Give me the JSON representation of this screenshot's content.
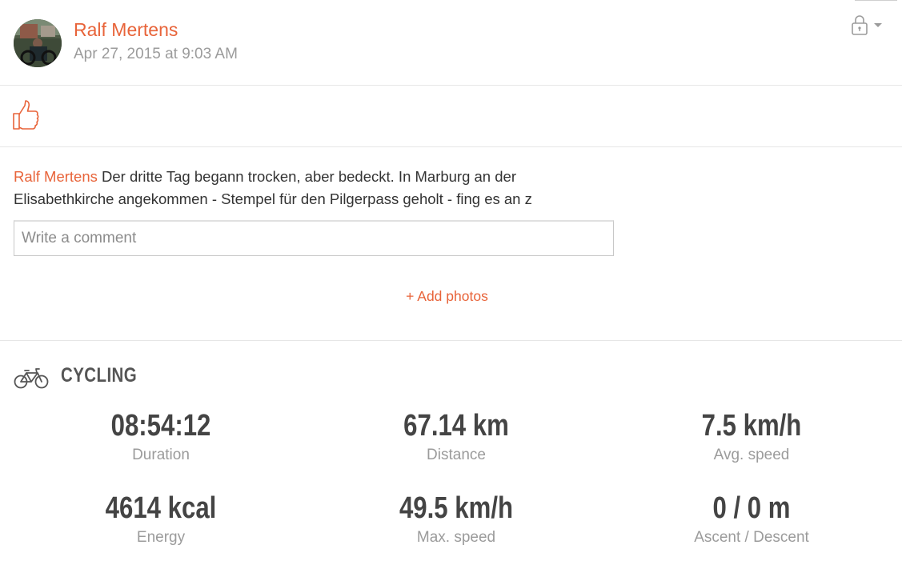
{
  "post": {
    "author": "Ralf Mertens",
    "timestamp": "Apr 27, 2015 at 9:03 AM",
    "text_author": "Ralf Mertens",
    "text_line1": " Der dritte Tag begann trocken, aber bedeckt. In Marburg an der",
    "text_line2": "Elisabethkirche angekommen - Stempel für den Pilgerpass geholt - fing es an z"
  },
  "icons": {
    "privacy": "lock-icon",
    "privacy_dropdown": "chevron-down-icon",
    "like": "thumbs-up-icon",
    "sport": "bicycle-icon"
  },
  "comment": {
    "placeholder": "Write a comment"
  },
  "actions": {
    "add_photos": "+ Add photos"
  },
  "workout": {
    "sport": "CYCLING",
    "stats": [
      {
        "value": "08:54:12",
        "label": "Duration"
      },
      {
        "value": "67.14 km",
        "label": "Distance"
      },
      {
        "value": "7.5 km/h",
        "label": "Avg. speed"
      },
      {
        "value": "4614 kcal",
        "label": "Energy"
      },
      {
        "value": "49.5 km/h",
        "label": "Max. speed"
      },
      {
        "value": "0 / 0 m",
        "label": "Ascent / Descent"
      }
    ]
  },
  "colors": {
    "accent": "#e8643a",
    "muted": "#9b9b9b",
    "stat_value": "#444444",
    "divider": "#e6e6e6"
  }
}
